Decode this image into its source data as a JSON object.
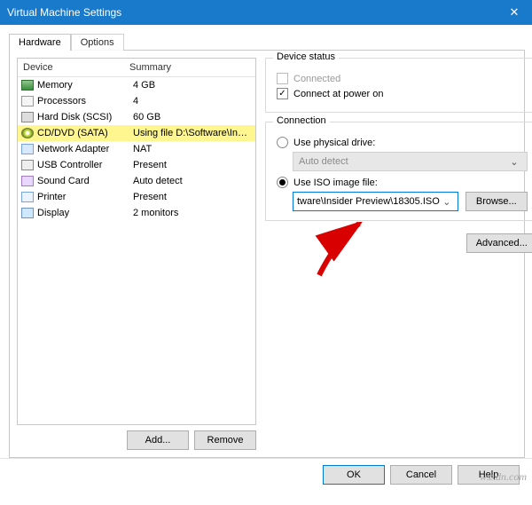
{
  "titlebar": {
    "title": "Virtual Machine Settings"
  },
  "tabs": {
    "hardware": "Hardware",
    "options": "Options"
  },
  "columns": {
    "device": "Device",
    "summary": "Summary"
  },
  "devices": [
    {
      "icon": "ic-mem",
      "name": "Memory",
      "summary": "4 GB"
    },
    {
      "icon": "ic-cpu",
      "name": "Processors",
      "summary": "4"
    },
    {
      "icon": "ic-hdd",
      "name": "Hard Disk (SCSI)",
      "summary": "60 GB"
    },
    {
      "icon": "ic-cd",
      "name": "CD/DVD (SATA)",
      "summary": "Using file D:\\Software\\Insider ...",
      "selected": true
    },
    {
      "icon": "ic-net",
      "name": "Network Adapter",
      "summary": "NAT"
    },
    {
      "icon": "ic-usb",
      "name": "USB Controller",
      "summary": "Present"
    },
    {
      "icon": "ic-snd",
      "name": "Sound Card",
      "summary": "Auto detect"
    },
    {
      "icon": "ic-prn",
      "name": "Printer",
      "summary": "Present"
    },
    {
      "icon": "ic-dsp",
      "name": "Display",
      "summary": "2 monitors"
    }
  ],
  "leftbtn": {
    "add": "Add...",
    "remove": "Remove"
  },
  "status": {
    "group": "Device status",
    "connected": "Connected",
    "power": "Connect at power on"
  },
  "connection": {
    "group": "Connection",
    "physical": "Use physical drive:",
    "physical_value": "Auto detect",
    "iso": "Use ISO image file:",
    "iso_value": "tware\\Insider Preview\\18305.ISO",
    "browse": "Browse..."
  },
  "advanced": "Advanced...",
  "buttons": {
    "ok": "OK",
    "cancel": "Cancel",
    "help": "Help"
  },
  "watermark": "wsxdn.com"
}
